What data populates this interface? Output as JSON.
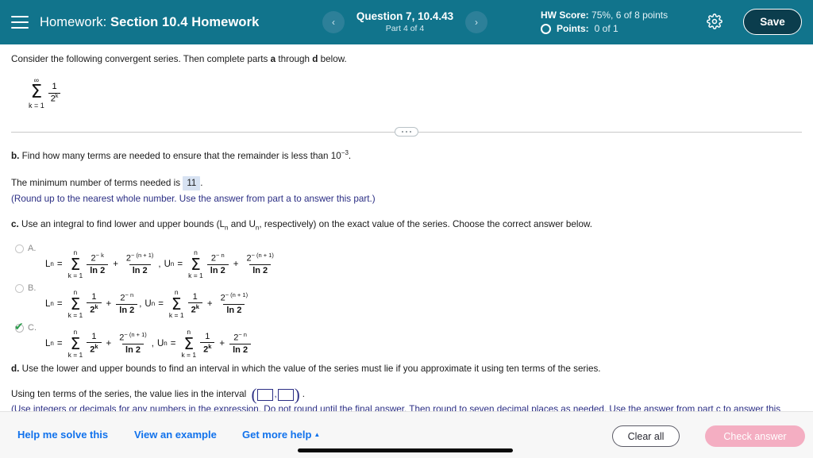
{
  "header": {
    "menu_icon": "hamburger-icon",
    "prefix": "Homework:",
    "title": "Section 10.4 Homework",
    "prev_icon": "‹",
    "next_icon": "›",
    "question_label": "Question 7, 10.4.43",
    "part_label": "Part 4 of 4",
    "hw_score_label": "HW Score:",
    "hw_score_value": "75%, 6 of 8 points",
    "points_label": "Points:",
    "points_value": "0 of 1",
    "gear_icon": "gear-icon",
    "save_label": "Save",
    "bg_color": "#11748c",
    "save_bg_color": "#0b3d4d"
  },
  "problem": {
    "intro_pre": "Consider the following convergent series. Then complete parts ",
    "intro_a": "a",
    "intro_mid": " through ",
    "intro_d": "d",
    "intro_post": " below.",
    "series": {
      "upper": "∞",
      "symbol": "Σ",
      "lower": "k = 1",
      "numerator": "1",
      "denominator": "2",
      "denominator_exp": "k"
    },
    "divider_handle_icon": "drag-handle-dots"
  },
  "part_b": {
    "label": "b.",
    "prompt": " Find how many terms are needed to ensure that the remainder is less than 10",
    "exponent": "−3",
    "prompt_end": ".",
    "answer_pre": "The minimum number of terms needed is",
    "answer_value": "11",
    "answer_post": ".",
    "note": "(Round up to the nearest whole number. Use the answer from part a to answer this part.)"
  },
  "part_c": {
    "label": "c.",
    "prompt_1": " Use an integral to find lower and upper bounds (L",
    "sub_n_1": "n",
    "prompt_2": " and U",
    "sub_n_2": "n",
    "prompt_3": ", respectively) on the exact value of the series. Choose the correct answer below.",
    "choices": [
      {
        "letter": "A.",
        "selected": false,
        "L_label": "L",
        "L_sub": "n",
        "eq": "=",
        "sum_top": "n",
        "sum_sym": "Σ",
        "sum_bot": "k = 1",
        "t1_num": "2",
        "t1_num_sup": "− k",
        "t1_den": "ln 2",
        "plus": "+",
        "t2_num": "2",
        "t2_num_sup": "− (n + 1)",
        "t2_den": "ln 2",
        "comma": ",",
        "U_label": "U",
        "U_sub": "n",
        "t3_num": "2",
        "t3_num_sup": "− n",
        "t3_den": "ln 2",
        "t4_num": "2",
        "t4_num_sup": "− (n + 1)",
        "t4_den": "ln 2"
      },
      {
        "letter": "B.",
        "selected": false,
        "L_label": "L",
        "L_sub": "n",
        "eq": "=",
        "sum_top": "n",
        "sum_sym": "Σ",
        "sum_bot": "k = 1",
        "t1_num": "1",
        "t1_num_sup": "",
        "t1_den": "2",
        "t1_den_sup": "k",
        "plus": "+",
        "t2_num": "2",
        "t2_num_sup": "− n",
        "t2_den": "ln 2",
        "comma": ",",
        "U_label": "U",
        "U_sub": "n",
        "t3_num": "1",
        "t3_num_sup": "",
        "t3_den": "2",
        "t3_den_sup": "k",
        "t4_num": "2",
        "t4_num_sup": "− (n + 1)",
        "t4_den": "ln 2"
      },
      {
        "letter": "C.",
        "selected": true,
        "L_label": "L",
        "L_sub": "n",
        "eq": "=",
        "sum_top": "n",
        "sum_sym": "Σ",
        "sum_bot": "k = 1",
        "t1_num": "1",
        "t1_num_sup": "",
        "t1_den": "2",
        "t1_den_sup": "k",
        "plus": "+",
        "t2_num": "2",
        "t2_num_sup": "− (n + 1)",
        "t2_den": "ln 2",
        "comma": ",",
        "U_label": "U",
        "U_sub": "n",
        "t3_num": "1",
        "t3_num_sup": "",
        "t3_den": "2",
        "t3_den_sup": "k",
        "t4_num": "2",
        "t4_num_sup": "− n",
        "t4_den": "ln 2"
      }
    ],
    "check_icon": "green-check-icon"
  },
  "part_d": {
    "label": "d.",
    "prompt": " Use the lower and upper bounds to find an interval in which the value of the series must lie if you approximate it using ten terms of the series.",
    "answer_pre": "Using ten terms of the series, the value lies in the interval",
    "open_paren": "(",
    "separator": ",",
    "close_paren": ")",
    "period": ".",
    "blank_1_value": "",
    "blank_2_value": "",
    "note": "(Use integers or decimals for any numbers in the expression. Do not round until the final answer. Then round to seven decimal places as needed. Use the answer from part c to answer this part.)"
  },
  "footer": {
    "help_solve": "Help me solve this",
    "view_example": "View an example",
    "get_more_help": "Get more help",
    "caret_icon": "▲",
    "clear_all": "Clear all",
    "check_answer": "Check answer",
    "link_color": "#1172ec",
    "check_btn_color": "#f4aec2"
  }
}
